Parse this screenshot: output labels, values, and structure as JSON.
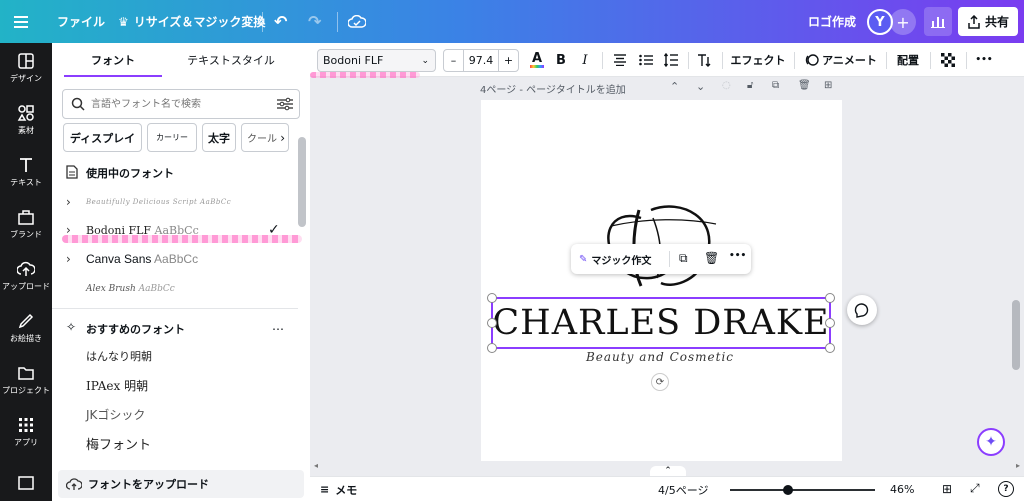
{
  "topbar": {
    "file_label": "ファイル",
    "resize_label": "リサイズ＆マジック変換",
    "logo_label": "ロゴ作成",
    "avatar_initial": "Y",
    "plus_label": "+",
    "share_label": "共有"
  },
  "rail": {
    "items": [
      {
        "label": "デザイン",
        "icon": "layout-icon"
      },
      {
        "label": "素材",
        "icon": "shapes-icon"
      },
      {
        "label": "テキスト",
        "icon": "text-icon"
      },
      {
        "label": "ブランド",
        "icon": "brand-icon"
      },
      {
        "label": "アップロード",
        "icon": "upload-icon"
      },
      {
        "label": "お絵描き",
        "icon": "draw-icon"
      },
      {
        "label": "プロジェクト",
        "icon": "folder-icon"
      },
      {
        "label": "アプリ",
        "icon": "apps-icon"
      }
    ]
  },
  "panel": {
    "tabs": [
      "フォント",
      "テキストスタイル"
    ],
    "active_tab": 0,
    "search_placeholder": "言語やフォント名で検索",
    "chips": [
      "ディスプレイ",
      "カーリー",
      "太字",
      "クール"
    ],
    "in_use_title": "使用中のフォント",
    "in_use_fonts": [
      {
        "name": "Beautifully Delicious Script",
        "sample": "AaBbCc",
        "selected": false
      },
      {
        "name": "Bodoni FLF",
        "sample": "AaBbCc",
        "selected": true
      },
      {
        "name": "Canva Sans",
        "sample": "AaBbCc",
        "selected": false
      },
      {
        "name": "Alex Brush",
        "sample": "AaBbCc",
        "selected": false
      }
    ],
    "recommended_title": "おすすめのフォント",
    "recommended_more": "…",
    "recommended_fonts": [
      "はんなり明朝",
      "IPAex 明朝",
      "JKゴシック",
      "梅フォント"
    ],
    "upload_label": "フォントをアップロード"
  },
  "toolbar": {
    "font_name": "Bodoni FLF",
    "font_size": "97.4",
    "minus": "–",
    "plus": "+",
    "bold": "B",
    "italic": "I",
    "effects_label": "エフェクト",
    "animate_label": "アニメート",
    "position_label": "配置",
    "more": "•••"
  },
  "canvas": {
    "page_title": "4ページ - ページタイトルを追加",
    "logo_name": "CHARLES DRAKE",
    "tagline": "Beauty and Cosmetic",
    "magic_write_label": "マジック作文",
    "more": "•••"
  },
  "bottombar": {
    "notes_label": "メモ",
    "page_indicator": "4/5ページ",
    "zoom": "46%",
    "zoom_fraction": 0.4,
    "help": "?"
  },
  "colors": {
    "accent": "#8b3dff",
    "rail_bg": "#18191b",
    "topbar_start": "#22b3c7",
    "topbar_end": "#7a3cf0"
  }
}
